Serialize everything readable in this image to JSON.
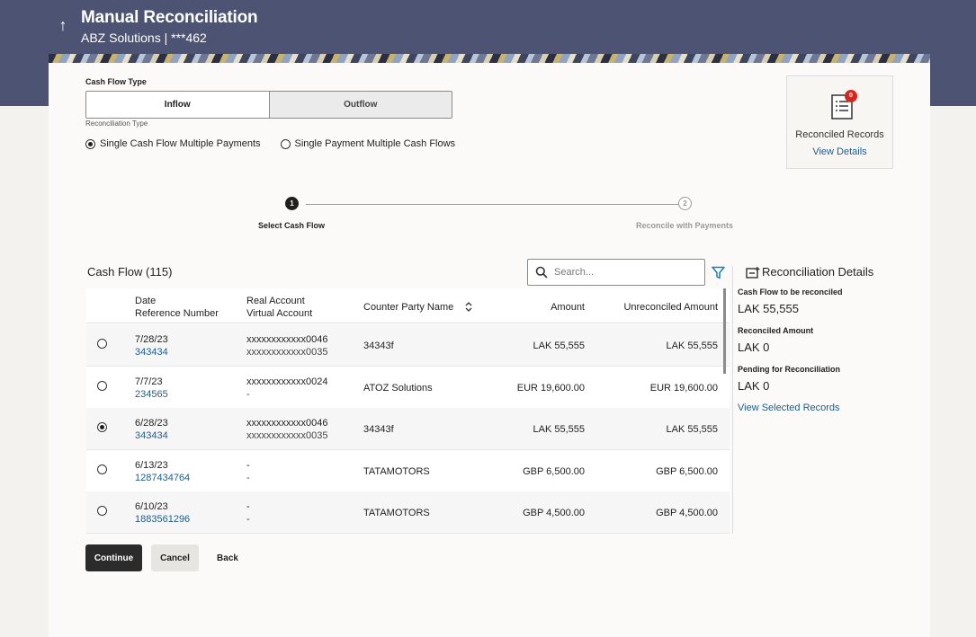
{
  "header": {
    "title": "Manual Reconciliation",
    "subtitle": "ABZ Solutions | ***462",
    "back_icon": "arrow-up-icon"
  },
  "cash_flow_type": {
    "label": "Cash Flow Type",
    "options": [
      "Inflow",
      "Outflow"
    ],
    "selected": "Inflow"
  },
  "reconciliation_type": {
    "label": "Reconciliation Type",
    "options": [
      "Single Cash Flow Multiple Payments",
      "Single Payment Multiple Cash Flows"
    ],
    "selected": "Single Cash Flow Multiple Payments"
  },
  "reconciled_records": {
    "badge": "0",
    "title": "Reconciled Records",
    "link": "View Details"
  },
  "stepper": {
    "steps": [
      {
        "number": "1",
        "label": "Select Cash Flow"
      },
      {
        "number": "2",
        "label": "Reconcile with Payments"
      }
    ],
    "current": 1
  },
  "cash_flow": {
    "title": "Cash Flow (115)",
    "search_placeholder": "Search...",
    "columns": {
      "date": "Date",
      "reference": "Reference Number",
      "real_account": "Real Account",
      "virtual_account": "Virtual Account",
      "counter_party": "Counter Party Name",
      "amount": "Amount",
      "unreconciled": "Unreconciled Amount"
    },
    "rows": [
      {
        "date": "7/28/23",
        "reference": "343434",
        "real_account": "xxxxxxxxxxxx0046",
        "virtual_account": "xxxxxxxxxxxx0035",
        "counter_party": "34343f",
        "amount": "LAK 55,555",
        "unreconciled": "LAK 55,555",
        "selected": false
      },
      {
        "date": "7/7/23",
        "reference": "234565",
        "real_account": "xxxxxxxxxxxx0024",
        "virtual_account": "-",
        "counter_party": "ATOZ Solutions",
        "amount": "EUR 19,600.00",
        "unreconciled": "EUR 19,600.00",
        "selected": false
      },
      {
        "date": "6/28/23",
        "reference": "343434",
        "real_account": "xxxxxxxxxxxx0046",
        "virtual_account": "xxxxxxxxxxxx0035",
        "counter_party": "34343f",
        "amount": "LAK 55,555",
        "unreconciled": "LAK 55,555",
        "selected": true
      },
      {
        "date": "6/13/23",
        "reference": "1287434764",
        "real_account": "-",
        "virtual_account": "-",
        "counter_party": "TATAMOTORS",
        "amount": "GBP 6,500.00",
        "unreconciled": "GBP 6,500.00",
        "selected": false
      },
      {
        "date": "6/10/23",
        "reference": "1883561296",
        "real_account": "-",
        "virtual_account": "-",
        "counter_party": "TATAMOTORS",
        "amount": "GBP 4,500.00",
        "unreconciled": "GBP 4,500.00",
        "selected": false
      }
    ]
  },
  "reconciliation_details": {
    "title": "Reconciliation Details",
    "cash_flow_label": "Cash Flow to be reconciled",
    "cash_flow_value": "LAK 55,555",
    "reconciled_label": "Reconciled Amount",
    "reconciled_value": "LAK 0",
    "pending_label": "Pending for Reconciliation",
    "pending_value": "LAK 0",
    "link": "View Selected Records"
  },
  "actions": {
    "continue": "Continue",
    "cancel": "Cancel",
    "back": "Back"
  },
  "colors": {
    "header": "#4c5373",
    "link": "#1b5e8e",
    "badge": "#d7261e",
    "primary_button": "#2b2b2b"
  }
}
